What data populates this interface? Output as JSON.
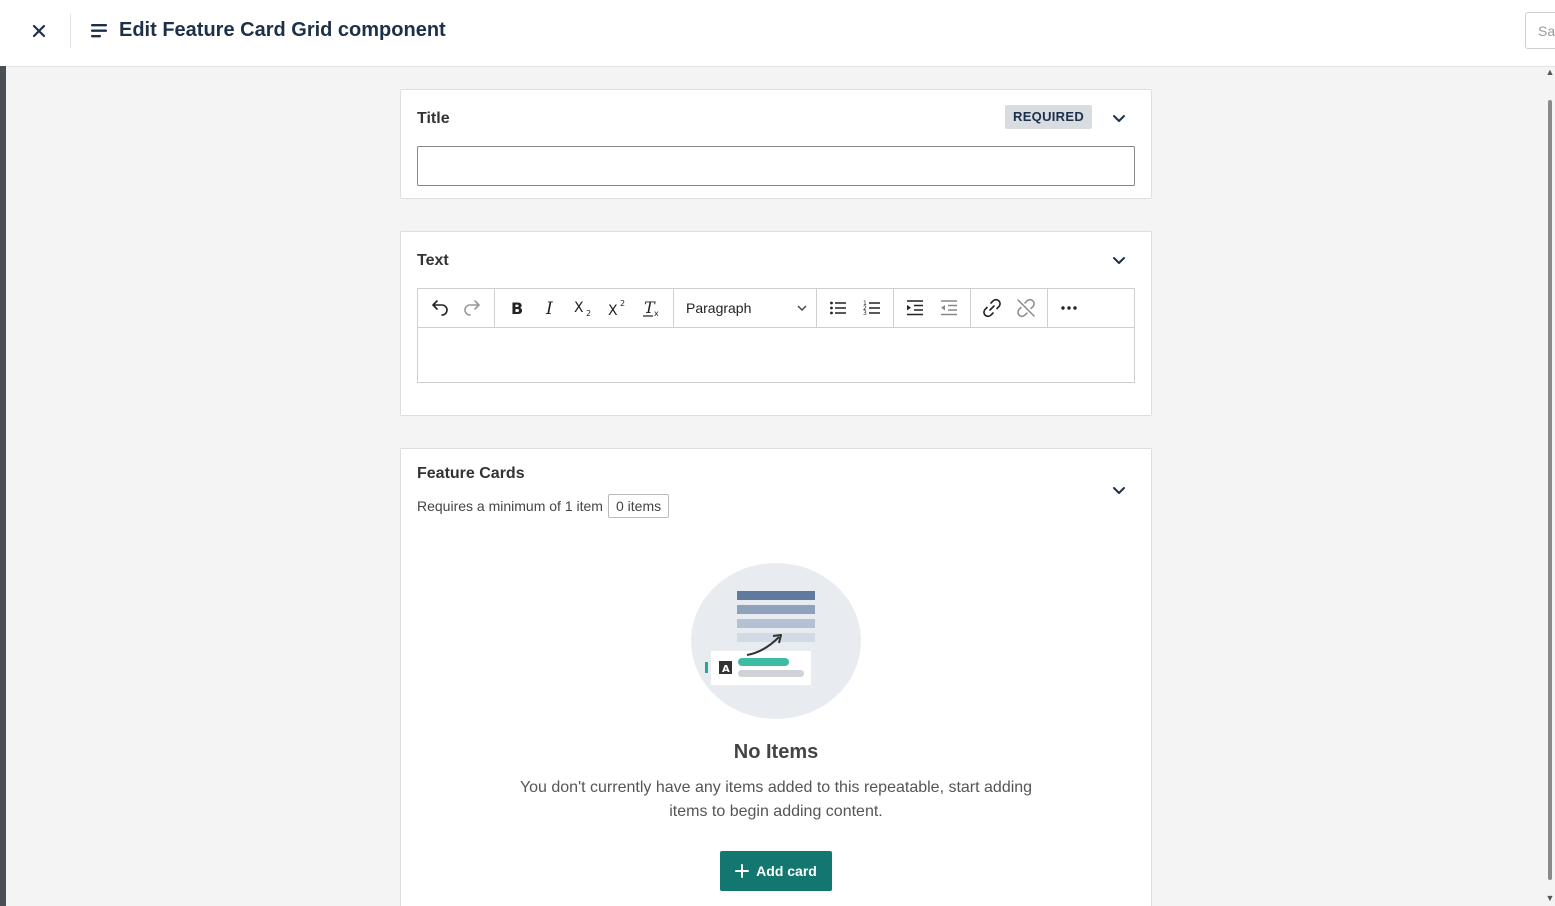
{
  "header": {
    "title": "Edit Feature Card Grid component",
    "save_label": "Save"
  },
  "fields": {
    "title": {
      "label": "Title",
      "badge": "REQUIRED",
      "value": ""
    },
    "text": {
      "label": "Text",
      "format_select": "Paragraph",
      "value": ""
    },
    "feature_cards": {
      "label": "Feature Cards",
      "requirement": "Requires a minimum of 1 item",
      "count": "0 items",
      "empty_title": "No Items",
      "empty_description": "You don't currently have any items added to this repeatable, start adding items to begin adding content.",
      "add_label": "Add card"
    }
  },
  "colors": {
    "accent": "#12786f",
    "heading": "#1d3049",
    "background": "#f4f4f4"
  }
}
